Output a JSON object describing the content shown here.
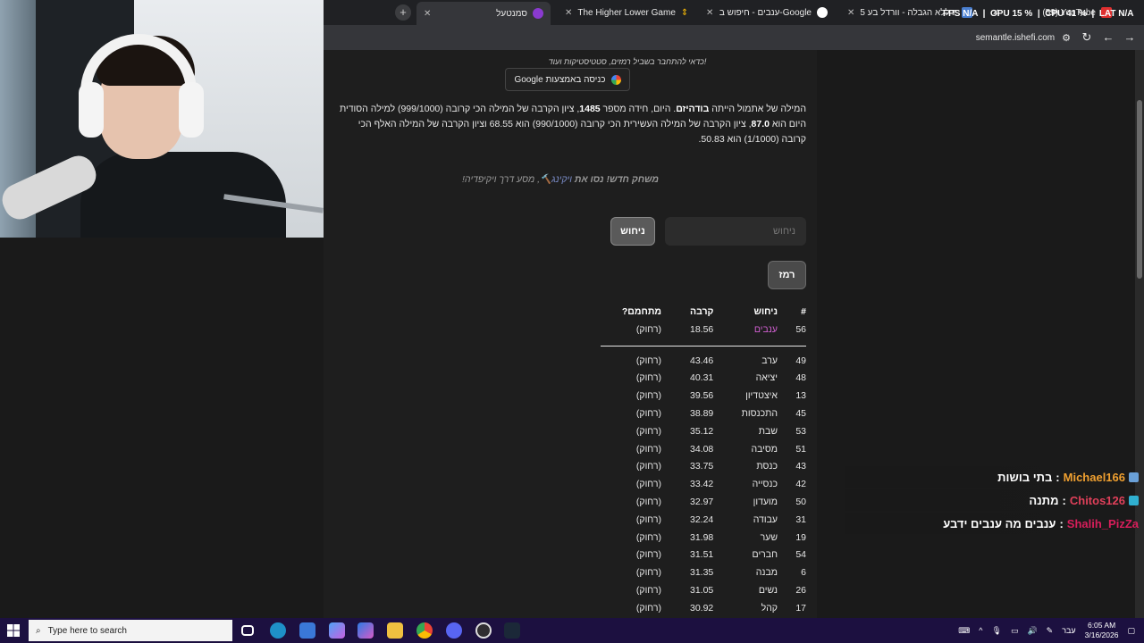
{
  "browser": {
    "tabs": [
      {
        "title": "סמנטעל",
        "active": true
      },
      {
        "title": "The Higher Lower Game",
        "active": false
      },
      {
        "title": "ענבים - חיפוש ב-Google",
        "active": false
      },
      {
        "title": "5 עשיות ללא הגבלה - וורדל בע...",
        "active": false
      },
      {
        "title": "(59) YouTube",
        "active": false
      }
    ],
    "url": "semantle.ishefi.com"
  },
  "hud": {
    "fps_label": "FPS",
    "fps_value": "N/A",
    "gpu_label": "GPU",
    "gpu_value": "15 %",
    "cpu_label": "CPU",
    "cpu_value": "41 %",
    "lat_label": "LAT",
    "lat_value": "N/A"
  },
  "page": {
    "login_note": "כדאי להתחבר בשביל רמזים, סטטיסטיקות ועוד!",
    "google_login": "כניסה באמצעות Google",
    "para_1": "המילה של אתמול הייתה ",
    "yesterday_word": "בודהיזם",
    "para_2": ". היום, חידה מספר ",
    "puzzle_number": "1485",
    "para_3": ", ציון הקרבה של המילה הכי קרובה (999/1000) למילה הסודית היום הוא ",
    "top_score": "87.0",
    "para_4": ", ציון הקרבה של המילה העשירית הכי קרובה (990/1000) הוא 68.55 וציון הקרבה של המילה האלף הכי קרובה (1/1000) הוא 50.83.",
    "new_game_bold": "משחק חדש! נסו את ",
    "new_game_link": "ויקינג",
    "new_game_rest": "🔨, מסע דרך ויקיפדיה!",
    "guess_placeholder": "ניחוש",
    "guess_button": "ניחוש",
    "hint_button": "רמז",
    "table": {
      "headers": [
        "#",
        "ניחוש",
        "קרבה",
        "מתחמם?"
      ],
      "latest": {
        "num": "56",
        "word": "ענבים",
        "score": "18.56",
        "status": "(רחוק)"
      },
      "rows": [
        {
          "num": "49",
          "word": "ערב",
          "score": "43.46",
          "status": "(רחוק)"
        },
        {
          "num": "48",
          "word": "יציאה",
          "score": "40.31",
          "status": "(רחוק)"
        },
        {
          "num": "13",
          "word": "איצטדיון",
          "score": "39.56",
          "status": "(רחוק)"
        },
        {
          "num": "45",
          "word": "התכנסות",
          "score": "38.89",
          "status": "(רחוק)"
        },
        {
          "num": "53",
          "word": "שבת",
          "score": "35.12",
          "status": "(רחוק)"
        },
        {
          "num": "51",
          "word": "מסיבה",
          "score": "34.08",
          "status": "(רחוק)"
        },
        {
          "num": "43",
          "word": "כנסת",
          "score": "33.75",
          "status": "(רחוק)"
        },
        {
          "num": "42",
          "word": "כנסייה",
          "score": "33.42",
          "status": "(רחוק)"
        },
        {
          "num": "50",
          "word": "מועדון",
          "score": "32.97",
          "status": "(רחוק)"
        },
        {
          "num": "31",
          "word": "עבודה",
          "score": "32.24",
          "status": "(רחוק)"
        },
        {
          "num": "19",
          "word": "שער",
          "score": "31.98",
          "status": "(רחוק)"
        },
        {
          "num": "54",
          "word": "חברים",
          "score": "31.51",
          "status": "(רחוק)"
        },
        {
          "num": "6",
          "word": "מבנה",
          "score": "31.35",
          "status": "(רחוק)"
        },
        {
          "num": "26",
          "word": "נשים",
          "score": "31.05",
          "status": "(רחוק)"
        },
        {
          "num": "17",
          "word": "קהל",
          "score": "30.92",
          "status": "(רחוק)"
        }
      ]
    }
  },
  "chat": [
    {
      "user": "Michael166",
      "message": "בתי בושות",
      "user_color": "#f0a030"
    },
    {
      "user": "Chitos126",
      "message": "מתנה",
      "user_color": "#e0405a"
    },
    {
      "user": "Shalih_PizZa",
      "message": "ענבים מה ענבים ידבע",
      "user_color": "#d81e5b"
    }
  ],
  "taskbar": {
    "search_placeholder": "Type here to search",
    "lang": "עבר",
    "time": "6:05 AM",
    "date": "3/16/2026"
  }
}
